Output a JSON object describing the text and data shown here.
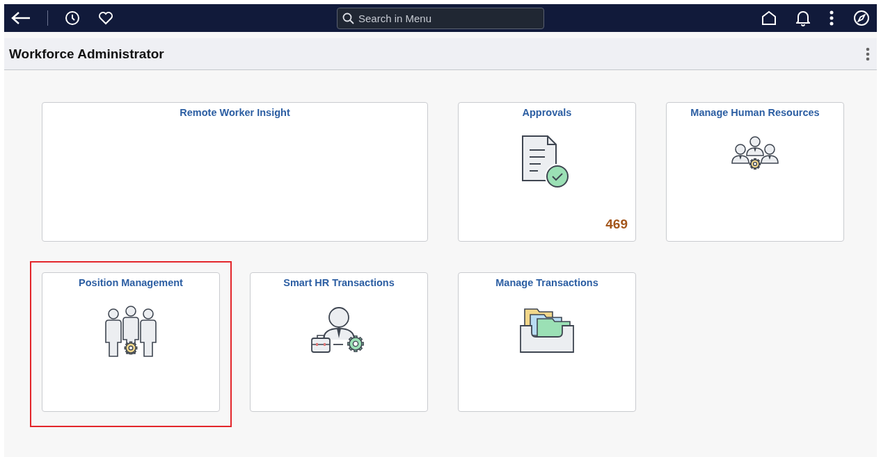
{
  "top_bar": {
    "search": {
      "placeholder": "Search in Menu"
    }
  },
  "page_header": {
    "title": "Workforce Administrator"
  },
  "tiles": [
    {
      "title": "Remote Worker Insight",
      "kind": "wide",
      "highlighted": false
    },
    {
      "title": "Approvals",
      "kind": "approvals",
      "badge": "469",
      "highlighted": false
    },
    {
      "title": "Manage Human Resources",
      "kind": "hr",
      "highlighted": false
    },
    {
      "title": "Position Management",
      "kind": "positions",
      "highlighted": true
    },
    {
      "title": "Smart HR Transactions",
      "kind": "smart",
      "highlighted": false
    },
    {
      "title": "Manage Transactions",
      "kind": "transactions",
      "highlighted": false
    }
  ]
}
